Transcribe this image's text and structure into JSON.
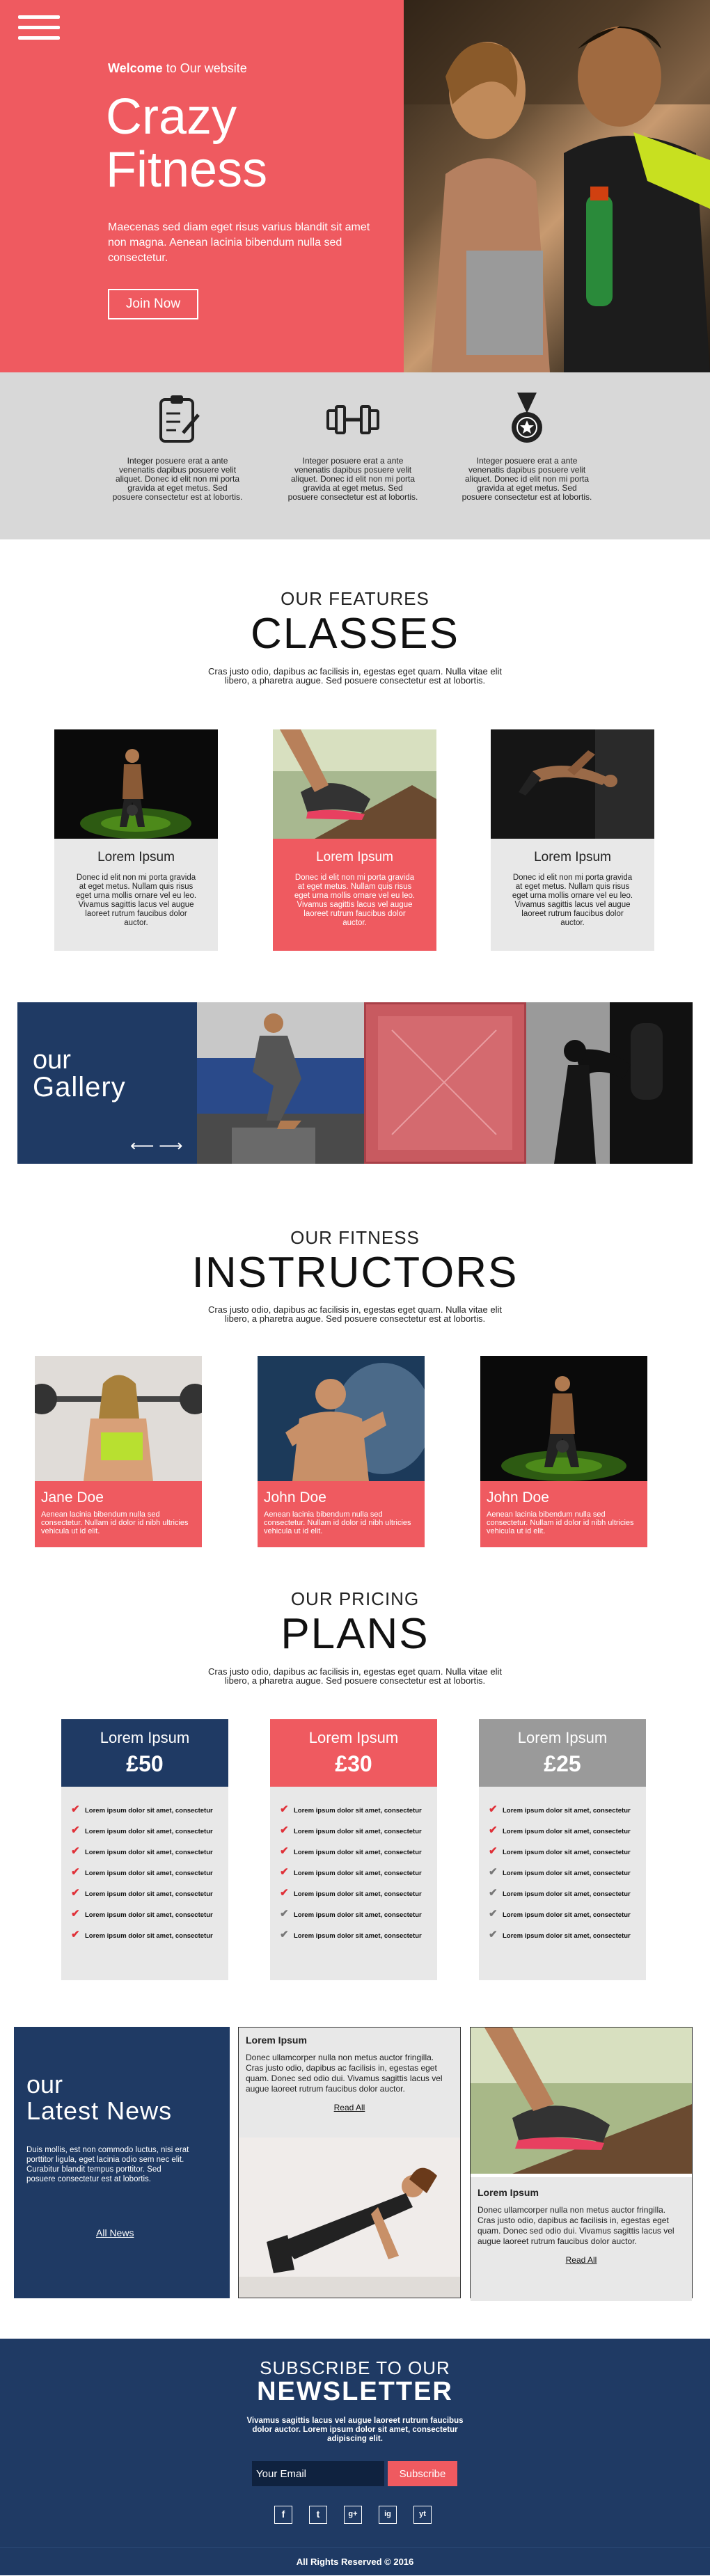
{
  "hero": {
    "welcome_bold": "Welcome",
    "welcome_rest": " to Our website",
    "title_line1": "Crazy",
    "title_line2": "Fitness",
    "text": "Maecenas sed diam eget risus varius blandit sit amet non magna. Aenean lacinia bibendum nulla sed consectetur.",
    "button": "Join Now"
  },
  "features": [
    {
      "icon": "clipboard-icon",
      "text": "Integer posuere erat a ante venenatis dapibus posuere velit aliquet. Donec id elit non mi porta gravida at eget metus. Sed posuere consectetur est at lobortis."
    },
    {
      "icon": "dumbbell-icon",
      "text": "Integer posuere erat a ante venenatis dapibus posuere velit aliquet. Donec id elit non mi porta gravida at eget metus. Sed posuere consectetur est at lobortis."
    },
    {
      "icon": "medal-icon",
      "text": "Integer posuere erat a ante venenatis dapibus posuere velit aliquet. Donec id elit non mi porta gravida at eget metus. Sed posuere consectetur est at lobortis."
    }
  ],
  "classes": {
    "sub": "OUR FEATURES",
    "title": "CLASSES",
    "text": "Cras justo odio, dapibus ac facilisis in, egestas eget quam. Nulla vitae elit libero, a pharetra augue. Sed posuere consectetur est at lobortis.",
    "cards": [
      {
        "title": "Lorem Ipsum",
        "text": "Donec id elit non mi porta gravida at eget metus. Nullam quis risus eget urna mollis ornare vel eu leo. Vivamus sagittis lacus vel augue laoreet rutrum faucibus dolor auctor."
      },
      {
        "title": "Lorem Ipsum",
        "text": "Donec id elit non mi porta gravida at eget metus. Nullam quis risus eget urna mollis ornare vel eu leo. Vivamus sagittis lacus vel augue laoreet rutrum faucibus dolor auctor."
      },
      {
        "title": "Lorem Ipsum",
        "text": "Donec id elit non mi porta gravida at eget metus. Nullam quis risus eget urna mollis ornare vel eu leo. Vivamus sagittis lacus vel augue laoreet rutrum faucibus dolor auctor."
      }
    ]
  },
  "gallery": {
    "line1": "our",
    "line2": "Gallery",
    "arrows": "⟵ ⟶"
  },
  "instructors": {
    "sub": "OUR FITNESS",
    "title": "INSTRUCTORS",
    "text": "Cras justo odio, dapibus ac facilisis in, egestas eget quam. Nulla vitae elit libero, a pharetra augue. Sed posuere consectetur est at lobortis.",
    "people": [
      {
        "name": "Jane Doe",
        "text": "Aenean lacinia bibendum nulla sed consectetur. Nullam id dolor id nibh ultricies vehicula ut id elit."
      },
      {
        "name": "John Doe",
        "text": "Aenean lacinia bibendum nulla sed consectetur. Nullam id dolor id nibh ultricies vehicula ut id elit."
      },
      {
        "name": "John Doe",
        "text": "Aenean lacinia bibendum nulla sed consectetur. Nullam id dolor id nibh ultricies vehicula ut id elit."
      }
    ]
  },
  "pricing": {
    "sub": "OUR PRICING",
    "title": "PLANS",
    "text": "Cras justo odio, dapibus ac facilisis in, egestas eget quam. Nulla vitae elit libero, a pharetra augue. Sed posuere consectetur est at lobortis.",
    "feature_text": "Lorem ipsum dolor sit amet, consectetur",
    "plans": [
      {
        "name": "Lorem Ipsum",
        "price": "£50",
        "color": "#1f3a64"
      },
      {
        "name": "Lorem Ipsum",
        "price": "£30",
        "color": "#ef5a60"
      },
      {
        "name": "Lorem Ipsum",
        "price": "£25",
        "color": "#9a9a9a"
      }
    ]
  },
  "news": {
    "line1": "our",
    "line2": "Latest News",
    "text": "Duis mollis, est non commodo luctus, nisi erat porttitor ligula, eget lacinia odio sem nec elit. Curabitur blandit tempus porttitor. Sed posuere consectetur est at lobortis.",
    "all": "All News",
    "cards": [
      {
        "title": "Lorem Ipsum",
        "text": "Donec ullamcorper nulla non metus auctor fringilla. Cras justo odio, dapibus ac facilisis in, egestas eget quam. Donec sed odio dui. Vivamus sagittis lacus vel augue laoreet rutrum faucibus dolor auctor.",
        "link": "Read All"
      },
      {
        "title": "Lorem Ipsum",
        "text": "Donec ullamcorper nulla non metus auctor fringilla. Cras justo odio, dapibus ac facilisis in, egestas eget quam. Donec sed odio dui. Vivamus sagittis lacus vel augue laoreet rutrum faucibus dolor auctor.",
        "link": "Read All"
      }
    ]
  },
  "newsletter": {
    "line1": "SUBSCRIBE TO OUR",
    "line2": "NEWSLETTER",
    "text": "Vivamus sagittis lacus vel augue laoreet rutrum faucibus dolor auctor. Lorem ipsum dolor sit amet, consectetur adipiscing elit.",
    "placeholder": "Your Email",
    "button": "Subscribe",
    "social": [
      "f",
      "t",
      "g+",
      "ig",
      "yt"
    ]
  },
  "footer": {
    "text": "All Rights Reserved © 2016"
  },
  "colors": {
    "accent": "#ef5a60",
    "navy": "#1f3a64",
    "grey": "#d8d8d8"
  }
}
